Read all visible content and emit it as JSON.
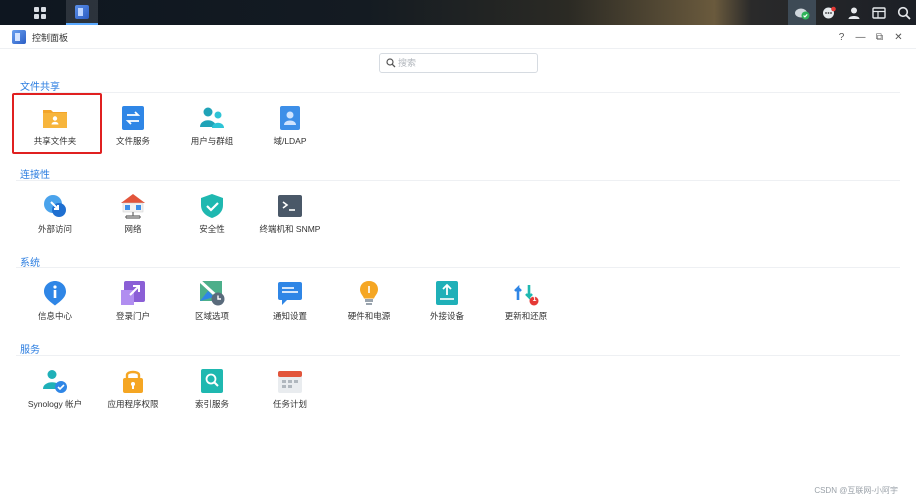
{
  "window": {
    "title": "控制面板",
    "help": "?",
    "minimize": "—",
    "restore": "⧉",
    "close": "✕"
  },
  "search": {
    "placeholder": "搜索"
  },
  "sections": [
    {
      "title": "文件共享",
      "items": [
        {
          "label": "共享文件夹",
          "icon": "shared-folder-icon"
        },
        {
          "label": "文件服务",
          "icon": "file-services-icon"
        },
        {
          "label": "用户与群组",
          "icon": "users-groups-icon"
        },
        {
          "label": "域/LDAP",
          "icon": "domain-ldap-icon"
        }
      ]
    },
    {
      "title": "连接性",
      "items": [
        {
          "label": "外部访问",
          "icon": "external-access-icon"
        },
        {
          "label": "网络",
          "icon": "network-icon"
        },
        {
          "label": "安全性",
          "icon": "security-shield-icon"
        },
        {
          "label": "终端机和 SNMP",
          "icon": "terminal-snmp-icon"
        }
      ]
    },
    {
      "title": "系统",
      "items": [
        {
          "label": "信息中心",
          "icon": "info-center-icon"
        },
        {
          "label": "登录门户",
          "icon": "login-portal-icon"
        },
        {
          "label": "区域选项",
          "icon": "regional-options-icon"
        },
        {
          "label": "通知设置",
          "icon": "notification-icon"
        },
        {
          "label": "硬件和电源",
          "icon": "hardware-power-icon"
        },
        {
          "label": "外接设备",
          "icon": "external-devices-icon"
        },
        {
          "label": "更新和还原",
          "icon": "update-restore-icon",
          "badge": "1"
        }
      ]
    },
    {
      "title": "服务",
      "items": [
        {
          "label": "Synology 帐户",
          "icon": "synology-account-icon"
        },
        {
          "label": "应用程序权限",
          "icon": "app-privileges-icon"
        },
        {
          "label": "索引服务",
          "icon": "indexing-service-icon"
        },
        {
          "label": "任务计划",
          "icon": "task-scheduler-icon"
        }
      ]
    }
  ],
  "watermark": "CSDN @互联网-小阿宇",
  "colors": {
    "accent": "#2b7de0",
    "highlight": "#e02020"
  }
}
